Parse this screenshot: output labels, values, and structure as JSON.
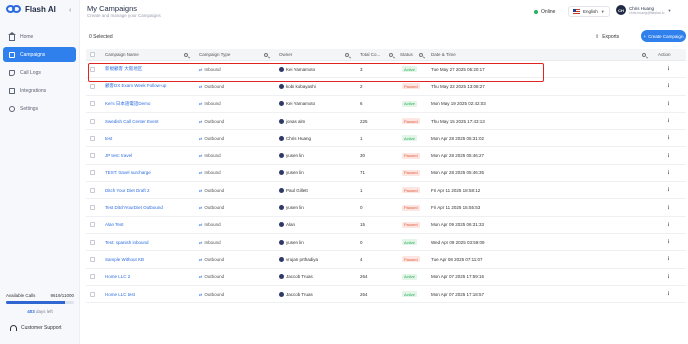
{
  "brand": {
    "name": "Flash AI"
  },
  "sidebar": {
    "items": [
      {
        "label": "Home",
        "icon": "home-icon"
      },
      {
        "label": "Campaigns",
        "icon": "campaign-icon",
        "active": true
      },
      {
        "label": "Call Logs",
        "icon": "call-logs-icon"
      },
      {
        "label": "Integrations",
        "icon": "integrations-icon"
      },
      {
        "label": "Settings",
        "icon": "settings-icon"
      }
    ],
    "usage": {
      "label": "Available Calls",
      "value": "9619/11000",
      "fraction": 0.874
    },
    "days_left": {
      "count": "403",
      "suffix": "days left"
    },
    "support_label": "Customer Support"
  },
  "header": {
    "title": "My Campaigns",
    "subtitle": "Create and manage your Campaigns",
    "status": "Online",
    "language": "English",
    "user": {
      "initials": "CH",
      "name": "Chris Huang",
      "email": "chris.huang@flashai.io"
    }
  },
  "toolbar": {
    "selected": "0 Selected",
    "exports": "Exports",
    "create": "Create Campaign"
  },
  "table": {
    "columns": [
      "Campaign Name",
      "Campaign Type",
      "Owner",
      "Total Co...",
      "Status",
      "Date & Time",
      "Action"
    ],
    "rows": [
      {
        "name": "新規顧客 大阪地区",
        "type": "Inbound",
        "owner": "Kei Yamamoto",
        "total": "3",
        "status": "Active",
        "date": "Tue May 27 2025 05:20:17"
      },
      {
        "name": "顧客DX Exam Week Follow-up",
        "type": "Outbound",
        "owner": "kobi kobayashi",
        "total": "2",
        "status": "Paused",
        "date": "Thu May 22 2025 13:08:27"
      },
      {
        "name": "Kei's 日本語電話Demo",
        "type": "Inbound",
        "owner": "Kei Yamamoto",
        "total": "6",
        "status": "Active",
        "date": "Mon May 19 2025 02:42:03"
      },
      {
        "name": "Swedish Call Center Event",
        "type": "Outbound",
        "owner": "jonas alm",
        "total": "225",
        "status": "Paused",
        "date": "Thu May 15 2025 17:43:13"
      },
      {
        "name": "test",
        "type": "Outbound",
        "owner": "Chris Huang",
        "total": "1",
        "status": "Active",
        "date": "Mon Apr 28 2025 05:31:02"
      },
      {
        "name": "JP test: travel",
        "type": "Inbound",
        "owner": "yusen lin",
        "total": "30",
        "status": "Paused",
        "date": "Mon Apr 28 2025 05:46:27"
      },
      {
        "name": "TEST: travel surcharge",
        "type": "Inbound",
        "owner": "yusen lin",
        "total": "71",
        "status": "Paused",
        "date": "Mon Apr 28 2025 05:46:35"
      },
      {
        "name": "Ditch Your Diet Draft 2",
        "type": "Outbound",
        "owner": "Paul Gillett",
        "total": "1",
        "status": "Paused",
        "date": "Fri Apr 11 2025 18:58:12"
      },
      {
        "name": "Test DitchYourDiet Outbound",
        "type": "Outbound",
        "owner": "yusen lin",
        "total": "0",
        "status": "Paused",
        "date": "Fri Apr 11 2025 15:55:53"
      },
      {
        "name": "Alan Test",
        "type": "Inbound",
        "owner": "Alan",
        "total": "15",
        "status": "Paused",
        "date": "Mon Apr 09 2025 06:31:33"
      },
      {
        "name": "Test: spanish inbound",
        "type": "Inbound",
        "owner": "yusen lin",
        "total": "0",
        "status": "Active",
        "date": "Wed Apr 09 2025 03:59:09"
      },
      {
        "name": "Sample Without KB",
        "type": "Outbound",
        "owner": "vrujan prthadiya",
        "total": "4",
        "status": "Paused",
        "date": "Tue Apr 08 2025 07:11:07"
      },
      {
        "name": "Home LLC 2",
        "type": "Outbound",
        "owner": "Jaccob Truas",
        "total": "264",
        "status": "Active",
        "date": "Mon Apr 07 2025 17:59:15"
      },
      {
        "name": "Home LLC test",
        "type": "Outbound",
        "owner": "Jaccob Truas",
        "total": "264",
        "status": "Active",
        "date": "Mon Apr 07 2025 17:18:57"
      }
    ]
  },
  "colors": {
    "accent": "#2f80ed",
    "active": "#27ae60",
    "paused": "#e05a3a",
    "highlight": "#e02424"
  }
}
